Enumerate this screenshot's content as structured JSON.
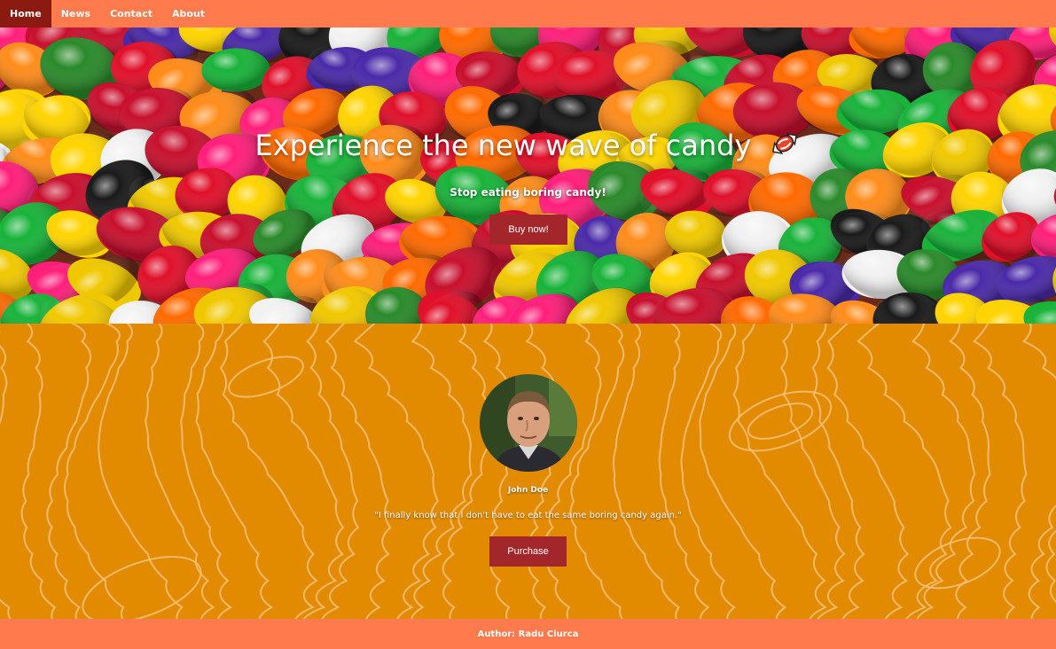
{
  "nav": {
    "items": [
      {
        "label": "Home",
        "active": true
      },
      {
        "label": "News",
        "active": false
      },
      {
        "label": "Contact",
        "active": false
      },
      {
        "label": "About",
        "active": false
      }
    ]
  },
  "hero": {
    "title": "Experience the new wave of candy",
    "title_icon": "candy-icon",
    "subtitle": "Stop eating boring candy!",
    "button_label": "Buy now!"
  },
  "testimonial": {
    "name": "John Doe",
    "quote": "\"I finally know that I don't have to eat the same boring candy again.\"",
    "button_label": "Purchase"
  },
  "footer": {
    "text": "Author: Radu Ciurca"
  },
  "colors": {
    "nav_bg": "#ff7b4d",
    "nav_active": "#8b1a10",
    "section_bg": "#e28b00",
    "button": "#a3272a"
  }
}
